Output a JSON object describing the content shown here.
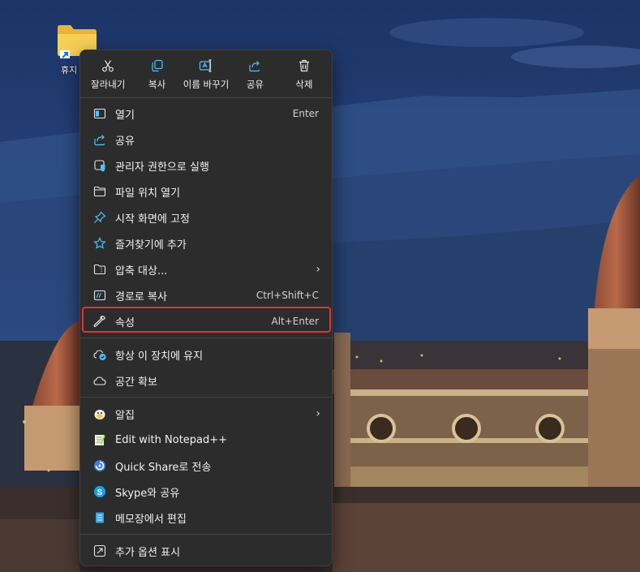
{
  "desktop": {
    "icon_label": "휴지"
  },
  "toolbar": [
    {
      "label": "잘라내기",
      "icon": "cut-icon"
    },
    {
      "label": "복사",
      "icon": "copy-icon"
    },
    {
      "label": "이름 바꾸기",
      "icon": "rename-icon"
    },
    {
      "label": "공유",
      "icon": "share-icon"
    },
    {
      "label": "삭제",
      "icon": "delete-icon"
    }
  ],
  "group1": [
    {
      "label": "열기",
      "shortcut": "Enter",
      "icon": "open-icon"
    },
    {
      "label": "공유",
      "shortcut": "",
      "icon": "share-icon"
    },
    {
      "label": "관리자 권한으로 실행",
      "shortcut": "",
      "icon": "admin-shield-icon"
    },
    {
      "label": "파일 위치 열기",
      "shortcut": "",
      "icon": "folder-icon"
    },
    {
      "label": "시작 화면에 고정",
      "shortcut": "",
      "icon": "pin-icon"
    },
    {
      "label": "즐겨찾기에 추가",
      "shortcut": "",
      "icon": "star-icon"
    },
    {
      "label": "압축 대상...",
      "shortcut": "",
      "icon": "zip-folder-icon",
      "submenu": true
    },
    {
      "label": "경로로 복사",
      "shortcut": "Ctrl+Shift+C",
      "icon": "path-icon"
    },
    {
      "label": "속성",
      "shortcut": "Alt+Enter",
      "icon": "wrench-icon"
    }
  ],
  "group2": [
    {
      "label": "항상 이 장치에 유지",
      "icon": "cloud-sync-icon"
    },
    {
      "label": "공간 확보",
      "icon": "cloud-icon"
    }
  ],
  "group3": [
    {
      "label": "알집",
      "icon": "alzip-icon",
      "submenu": true
    },
    {
      "label": "Edit with Notepad++",
      "icon": "notepadpp-icon"
    },
    {
      "label": "Quick Share로 전송",
      "icon": "quick-share-icon"
    },
    {
      "label": "Skype와 공유",
      "icon": "skype-icon"
    },
    {
      "label": "메모장에서 편집",
      "icon": "notepad-icon"
    }
  ],
  "group4": [
    {
      "label": "추가 옵션 표시",
      "icon": "more-options-icon"
    }
  ],
  "submenu_chevron": "›",
  "colors": {
    "highlight": "#e0342f",
    "menu_bg": "#2c2c2c",
    "accent": "#4cc2ff"
  }
}
